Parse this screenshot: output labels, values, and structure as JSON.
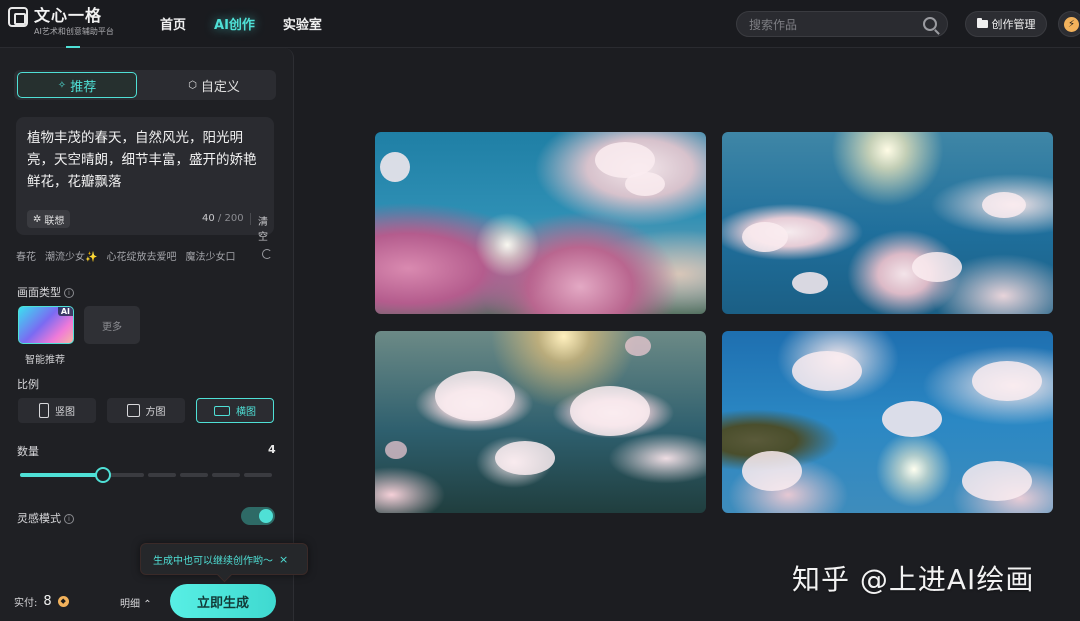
{
  "brand": {
    "title": "文心一格",
    "subtitle": "AI艺术和创意辅助平台"
  },
  "nav": {
    "items": [
      {
        "label": "首页",
        "active": false
      },
      {
        "label": "AI创作",
        "active": true
      },
      {
        "label": "实验室",
        "active": false
      }
    ]
  },
  "search": {
    "placeholder": "搜索作品"
  },
  "header": {
    "manage_label": "创作管理",
    "energy_icon": "lightning-icon"
  },
  "panel": {
    "mode_tabs": [
      {
        "label": "推荐",
        "active": true,
        "icon": "sparkle-icon"
      },
      {
        "label": "自定义",
        "active": false,
        "icon": "hexagon-icon"
      }
    ],
    "prompt": {
      "text": "植物丰茂的春天，自然风光，阳光明亮，天空晴朗，细节丰富，盛开的娇艳鲜花，花瓣飘落",
      "assoc_label": "联想",
      "count": "40",
      "max": "/ 200",
      "clear_label": "清空"
    },
    "tags": [
      "春花",
      "潮流少女✨",
      "心花绽放去爱吧",
      "魔法少女口"
    ],
    "style": {
      "label": "画面类型",
      "selected_name": "智能推荐",
      "badge": "AI",
      "more_label": "更多"
    },
    "ratio": {
      "label": "比例",
      "options": [
        {
          "label": "竖图",
          "active": false
        },
        {
          "label": "方图",
          "active": false
        },
        {
          "label": "横图",
          "active": true
        }
      ]
    },
    "quantity": {
      "label": "数量",
      "value": "4",
      "fraction": 0.33
    },
    "inspiration": {
      "label": "灵感模式",
      "enabled": true
    },
    "tooltip": {
      "text": "生成中也可以继续创作哟～",
      "close": "×"
    },
    "footer": {
      "cost_label": "实付:",
      "cost_value": "8",
      "detail_label": "明细",
      "generate_label": "立即生成"
    }
  },
  "colors": {
    "accent": "#4fe0d6",
    "background": "#1c1d21",
    "panel": "#1f2024"
  },
  "watermark": "知乎 @上进AI绘画"
}
